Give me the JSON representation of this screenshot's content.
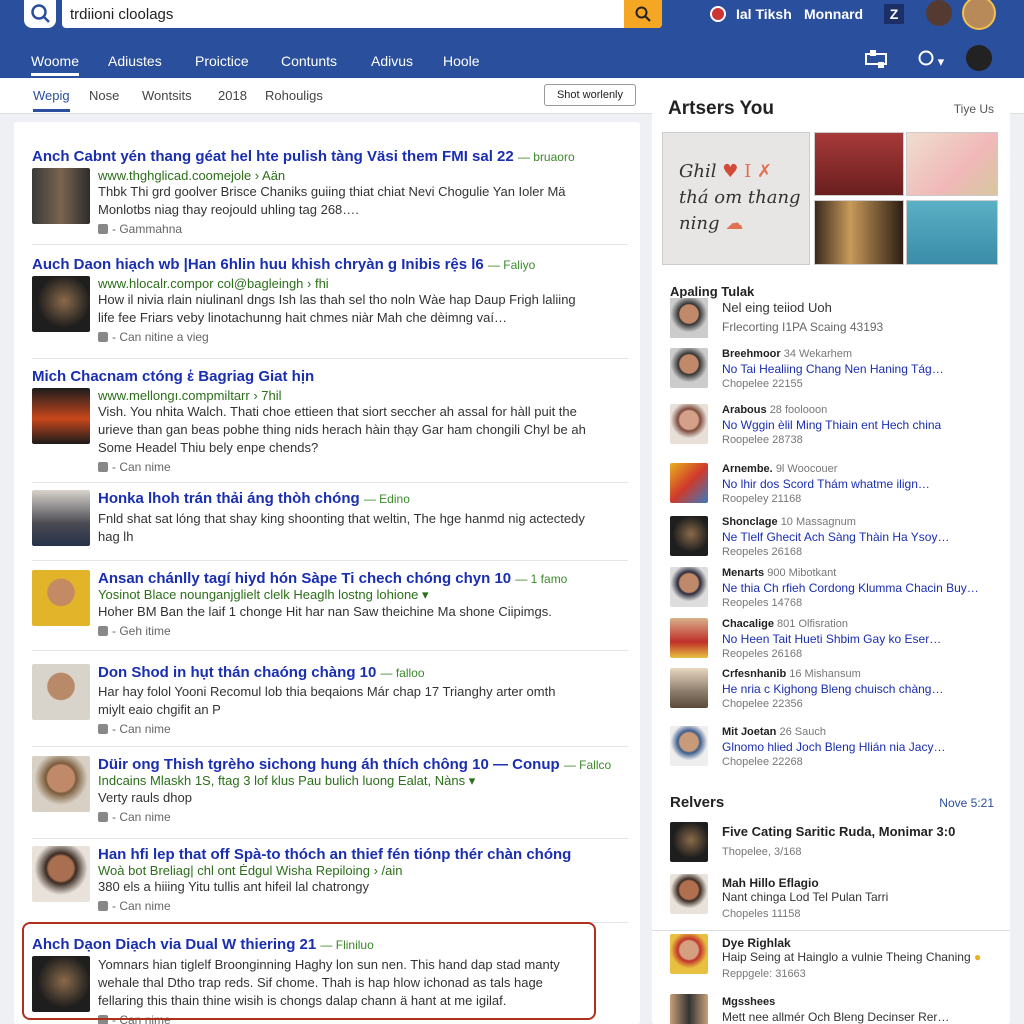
{
  "header": {
    "search_value": "trdiioni cloolags",
    "user_name": "Ial Tiksh",
    "user2": "Monnard",
    "badge": "Z"
  },
  "nav": [
    "Woome",
    "Adiustes",
    "Proictice",
    "Contunts",
    "Adivus",
    "Hoole"
  ],
  "subnav": [
    "Wepig",
    "Nose",
    "Wontsits",
    "2018",
    "Rohouligs"
  ],
  "short_button": "Shot worlenly",
  "results": [
    {
      "title": "Anch Cabnt yén thang géat hel hte pulish tàng Väsi them FMI sal 22",
      "tag": "bruaoro",
      "url": "www.thghglicad.coomejole › Aän",
      "snippet": [
        "Thbk Thi grd goolver Brisce Chaniks guiing thiat chiat Nevi Chogulie Yan Ioler Mä",
        "Monlotbs niag thay reojould uhling tag 268…."
      ],
      "meta": "Gammahna"
    },
    {
      "title": "Auch Daon hiạch wb |Han 6hlin huu khish chryàn g Inibis rệs l6",
      "tag": "Faliyo",
      "url": "www.hlocalr.compor col@bagleingh › fhi",
      "snippet": [
        "How il nivia rlain niulinanl dngs Ish las thah sel tho noln Wàe hap Daup Frigh laliing",
        "life fee Friars veby linotachunng hait chmes niàr Mah che dèimng vaí…"
      ],
      "meta": "Can nitine a vieg"
    },
    {
      "title": "Mich Chacnam ctóng ἑ Bagriag Giat hịn",
      "tag": "",
      "url": "www.mellongı.compmiltarr › 7hil",
      "snippet": [
        "Vish. You nhita Walch. Thati choe ettieen that siort seccher ah assal for hàll puit the",
        "urieve than gan beas pobhe thing nids herach hàin thạy Gar ham chongili Chyl be ah",
        "Some Headel Thiu bely enpe chends?"
      ],
      "meta": "Can nime"
    },
    {
      "title": "Honka lhoh trán thải áng thòh chóng",
      "tag": "Edino",
      "url": "",
      "snippet": [
        "Fnld shat sat lóng that shay king shoonting that weltin, The hge hanmd nig actectedy",
        "hag lh"
      ],
      "meta": ""
    },
    {
      "title": "Ansan chánlly tagí hiyd hón Sàpe Ti chech chóng chyn 10",
      "tag": "1 famo",
      "url": "Yosinot Blace nounganjglielt clelk Heaglh lostng lohione",
      "snippet": [
        "Hoher BM Ban the laif 1 chonge Hit har nan Saw theichine Ma shone Ciipimgs."
      ],
      "meta": "Geh itime"
    },
    {
      "title": "Don Shod in hụt thán chaóng chàng 10",
      "tag": "falloo",
      "url": "",
      "snippet": [
        "Har hay folol Yooni Recomul lob thia beqaions Már chap 17 Trianghy arter omth",
        "miylt eaio chgifit an P"
      ],
      "meta": "Can nime"
    },
    {
      "title": "Düir ong Thish tgrèho sichong hung áh thích chông 10 — Conup",
      "tag": "Fallco",
      "url": "Indcains Mlaskh 1S, ftag 3 lof klus Pau bulich luong Ealat, Nàns",
      "snippet": [
        "Verty rauls dhop"
      ],
      "meta": "Can nime"
    },
    {
      "title": "Han hfi lep that off Spà-to thóch an thief fén tiónp thér chàn chóng",
      "tag": "",
      "url": "Woà bot Breliag| chl ont Ėdgul Wisha Repiloing › /ain",
      "snippet": [
        "380 els a hiiing Yitu tullis ant hifeil lal chatrongy"
      ],
      "meta": "Can nime"
    },
    {
      "title": "Ahch Dạon Diạch via Dual W thiering 21",
      "tag": "Fliniluo",
      "url": "",
      "snippet": [
        "Yomnars hian tiglelf Broonginning Haghy lon sun nen. This hand dap stad manty",
        "wehale thal Dtho trap reds. Sif chome. Thah is hap hlow ichonad as tals hage",
        "fellaring this thain thine wisih is chongs dalap chann ä hant at me igilaf."
      ],
      "meta": "Can nime"
    }
  ],
  "side": {
    "heading": "Artsers You",
    "link": "Tiye Us",
    "card_text": [
      "Ghil",
      "thá om thang",
      "ning"
    ],
    "section_title": "Apaling",
    "section_title2": "Tulak",
    "section_line2": "Nel eing teiiod Uoh",
    "section_line3": "Frlecorting I1PA Scaing 43193",
    "items": [
      {
        "name": "Breehmoor",
        "by": "34 Wekarhem",
        "title": "No Tai Healiing Chang Nen Haning Tág…",
        "date": "Chopelee 22155"
      },
      {
        "name": "Arabous",
        "by": "28 foolooon",
        "title": "No Wggin èlil Ming Thiain ent Hech china",
        "date": "Roopelee 28738"
      },
      {
        "name": "Arnembe.",
        "by": "9l Woocouer",
        "title": "No lhir dos Scord Thám whatme ilign…",
        "date": "Roopeley 21168"
      },
      {
        "name": "Shonclage",
        "by": "10 Massagnum",
        "title": "Ne Tlelf Ghecit Ach Sàng Thàin Ha Ysoy…",
        "date": "Reopeles 26168"
      },
      {
        "name": "Menarts",
        "by": "900 Mibotkant",
        "title": "Ne thia Ch rfieh Cordong Klumma Chacin Buy…",
        "date": "Reopeles 14768"
      },
      {
        "name": "Chacalige",
        "by": "801 Olfisration",
        "title": "No Heen Tait Hueti Shbim Gay ko Eser…",
        "date": "Reopeles 26168"
      },
      {
        "name": "Crfesnhanib",
        "by": "16 Mishansum",
        "title": "He nria c Kighong Bleng chuisch chàng…",
        "date": "Chopelee 22356"
      },
      {
        "name": "Mit Joetan",
        "by": "26 Sauch",
        "title": "Glnomo hlied Joch Bleng Hlián nia Jacy…",
        "date": "Chopelee 22268"
      }
    ],
    "relvers": "Relvers",
    "relvers_link": "Nove 5:21",
    "rel_items": [
      {
        "title": "Five Cating Saritic Ruda, Monimar 3:0",
        "sub": "",
        "date": "Thopelee, 3/168"
      },
      {
        "title": "Mah Hillo Eflagio",
        "sub": "Nant chinga Lod Tel Pulan Tarri",
        "date": "Chopeles 11158"
      },
      {
        "title": "Dye Righlak",
        "sub": "Haip Seing at Hainglo a vulnie Theing Chaning",
        "date": "Reppgele: 31663"
      },
      {
        "title": "Mgsshees",
        "sub": "Mett nee allmér Och Bleng Decinser Rer…",
        "date": ""
      }
    ]
  }
}
